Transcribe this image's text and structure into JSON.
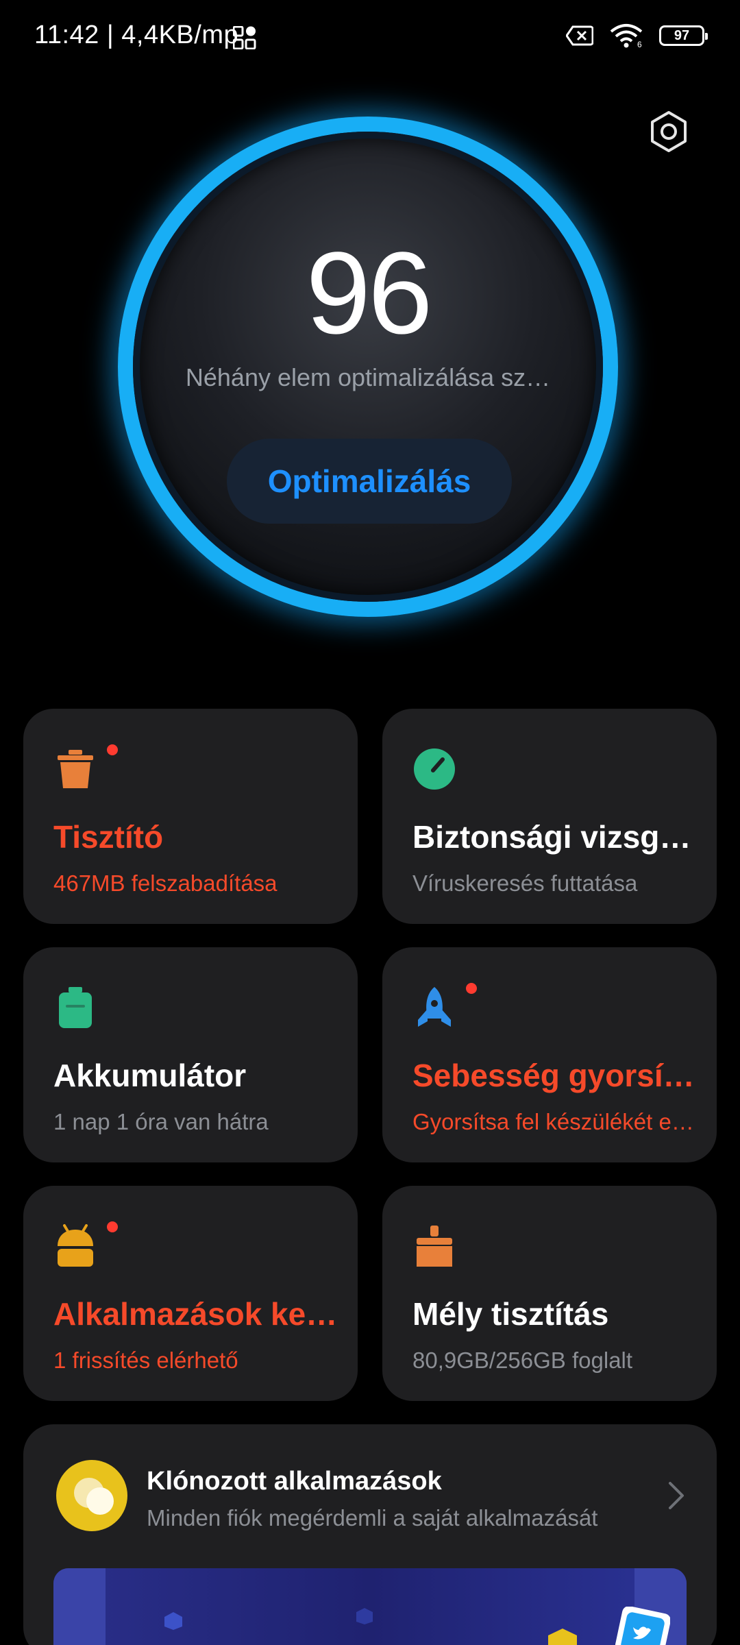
{
  "status_bar": {
    "time_speed": "11:42 | 4,4KB/mp",
    "battery": "97",
    "icons": [
      "grid-icon",
      "sim-off-icon",
      "wifi-icon",
      "battery-icon"
    ]
  },
  "header": {
    "settings_icon": "gear-hexagon-icon"
  },
  "score": {
    "value": "96",
    "description": "Néhány elem optimalizálása sz…",
    "button_label": "Optimalizálás",
    "ring_color": "#18aef5"
  },
  "cards": [
    {
      "id": "cleaner",
      "title": "Tisztító",
      "subtitle": "467MB felszabadítása",
      "icon": "trash-can-icon",
      "icon_color": "#e8803a",
      "alert": true,
      "highlight": true
    },
    {
      "id": "security",
      "title": "Biztonsági vizsgál…",
      "subtitle": "Víruskeresés futtatása",
      "icon": "shield-gauge-icon",
      "icon_color": "#2cb985",
      "alert": false,
      "highlight": false
    },
    {
      "id": "battery",
      "title": "Akkumulátor",
      "subtitle": "1 nap 1 óra  van hátra",
      "icon": "battery-icon",
      "icon_color": "#2cb985",
      "alert": false,
      "highlight": false
    },
    {
      "id": "boost",
      "title": "Sebesség gyorsít…",
      "subtitle": "Gyorsítsa fel készülékét en…",
      "icon": "rocket-icon",
      "icon_color": "#2f8ee8",
      "alert": true,
      "highlight": true
    },
    {
      "id": "apps",
      "title": "Alkalmazások kez…",
      "subtitle": "1 frissítés elérhető",
      "icon": "android-icon",
      "icon_color": "#e8a21a",
      "alert": true,
      "highlight": true
    },
    {
      "id": "deepclean",
      "title": "Mély tisztítás",
      "subtitle": "80,9GB/256GB foglalt",
      "icon": "brush-icon",
      "icon_color": "#e8803a",
      "alert": false,
      "highlight": false
    }
  ],
  "clone": {
    "title": "Klónozott alkalmazások",
    "subtitle": "Minden fiók megérdemli a saját alkalmazását",
    "icon": "clone-circles-icon"
  }
}
